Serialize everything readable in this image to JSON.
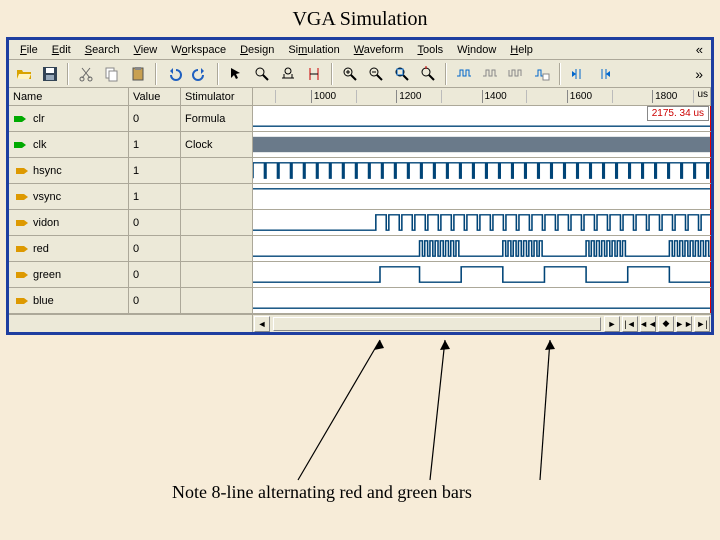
{
  "title": "VGA Simulation",
  "menu": {
    "file": "File",
    "edit": "Edit",
    "search": "Search",
    "view": "View",
    "workspace": "Workspace",
    "design": "Design",
    "simulation": "Simulation",
    "waveform": "Waveform",
    "tools": "Tools",
    "window": "Window",
    "help": "Help"
  },
  "headers": {
    "name": "Name",
    "value": "Value",
    "stim": "Stimulator"
  },
  "timeline": {
    "unit": "us",
    "ticks": [
      "1000",
      "1200",
      "1400",
      "1600",
      "1800"
    ],
    "cursor": "2175. 34 us"
  },
  "signals": [
    {
      "name": "clr",
      "value": "0",
      "stim": "Formula",
      "kind": "in"
    },
    {
      "name": "clk",
      "value": "1",
      "stim": "Clock",
      "kind": "in"
    },
    {
      "name": "hsync",
      "value": "1",
      "stim": "",
      "kind": "out"
    },
    {
      "name": "vsync",
      "value": "1",
      "stim": "",
      "kind": "out"
    },
    {
      "name": "vidon",
      "value": "0",
      "stim": "",
      "kind": "out"
    },
    {
      "name": "red",
      "value": "0",
      "stim": "",
      "kind": "out"
    },
    {
      "name": "green",
      "value": "0",
      "stim": "",
      "kind": "out"
    },
    {
      "name": "blue",
      "value": "0",
      "stim": "",
      "kind": "out"
    }
  ],
  "annotation": "Note 8-line alternating red and green bars"
}
